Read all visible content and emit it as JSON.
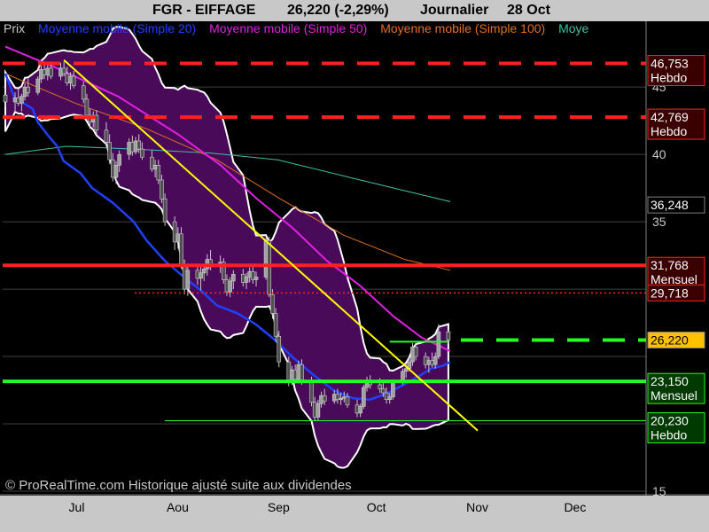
{
  "header": {
    "symbol": "FGR - EIFFAGE",
    "price_change": "26,220 (-2,29%)",
    "period": "Journalier",
    "date": "28 Oct"
  },
  "legend": {
    "items": [
      {
        "label": "Prix",
        "color": "#c8c8c8"
      },
      {
        "label": "Moyenne mobile (Simple 20)",
        "color": "#2040ff"
      },
      {
        "label": "Moyenne mobile (Simple 50)",
        "color": "#e020e0"
      },
      {
        "label": "Moyenne mobile (Simple 100)",
        "color": "#e07020"
      },
      {
        "label": "Moye",
        "color": "#40c0a0"
      }
    ]
  },
  "copyright": "© ProRealTime.com Historique ajusté suite aux dividendes",
  "chart_data": {
    "type": "candlestick",
    "y_axis": {
      "ticks": [
        15,
        20,
        25,
        30,
        35,
        40,
        45
      ],
      "tick_labels": [
        "15",
        "",
        "",
        "",
        "35",
        "40",
        "45"
      ],
      "ylim": [
        15,
        48.5
      ],
      "position": "right"
    },
    "x_axis": {
      "tick_labels": [
        "Jul",
        "Aou",
        "Sep",
        "Oct",
        "Nov",
        "Dec"
      ]
    },
    "horizontal_levels": [
      {
        "value": 46.753,
        "label": "46,753",
        "sublabel": "Hebdo",
        "color": "#ff2020",
        "style": "dashed"
      },
      {
        "value": 42.769,
        "label": "42,769",
        "sublabel": "Hebdo",
        "color": "#ff2020",
        "style": "dashed"
      },
      {
        "value": 31.768,
        "label": "31,768",
        "sublabel": "Mensuel",
        "color": "#ff2020",
        "style": "solid"
      },
      {
        "value": 29.718,
        "label": "29,718",
        "sublabel": "",
        "color": "#ff2020",
        "style": "dotted"
      },
      {
        "value": 26.22,
        "label": "26,220",
        "sublabel": "",
        "color": "#22ff22",
        "style": "dashed"
      },
      {
        "value": 23.15,
        "label": "23,150",
        "sublabel": "Mensuel",
        "color": "#22ff22",
        "style": "solid"
      },
      {
        "value": 20.23,
        "label": "20,230",
        "sublabel": "Hebdo",
        "color": "#22ff22",
        "style": "thin"
      }
    ],
    "value_labels": [
      {
        "value": 36.248,
        "label": "36,248",
        "bg": "#000000",
        "color": "#ffffff"
      },
      {
        "value": 26.22,
        "label": "26,220",
        "bg": "#ffc000",
        "color": "#000000"
      }
    ],
    "trendlines": [
      {
        "name": "downtrend",
        "color": "#ffff00",
        "points": [
          [
            "2024-07-02",
            47.0
          ],
          [
            "2024-11-06",
            19.5
          ]
        ]
      },
      {
        "name": "resistance",
        "color": "#22ff22",
        "points": [
          [
            "2024-10-10",
            26.1
          ],
          [
            "2024-10-28",
            26.1
          ]
        ]
      }
    ],
    "candles": [
      {
        "d": "2024-06-14",
        "o": 44.4,
        "h": 45.0,
        "l": 43.5,
        "c": 43.9
      },
      {
        "d": "2024-06-17",
        "o": 43.9,
        "h": 44.6,
        "l": 43.2,
        "c": 44.2
      },
      {
        "d": "2024-06-18",
        "o": 44.2,
        "h": 44.9,
        "l": 43.6,
        "c": 43.8
      },
      {
        "d": "2024-06-19",
        "o": 43.8,
        "h": 44.5,
        "l": 43.2,
        "c": 44.3
      },
      {
        "d": "2024-06-20",
        "o": 44.3,
        "h": 45.3,
        "l": 44.0,
        "c": 45.0
      },
      {
        "d": "2024-06-21",
        "o": 45.0,
        "h": 45.6,
        "l": 44.3,
        "c": 44.6
      },
      {
        "d": "2024-06-24",
        "o": 44.6,
        "h": 45.8,
        "l": 44.4,
        "c": 45.6
      },
      {
        "d": "2024-06-25",
        "o": 45.6,
        "h": 46.6,
        "l": 45.3,
        "c": 46.3
      },
      {
        "d": "2024-06-26",
        "o": 46.3,
        "h": 46.9,
        "l": 45.6,
        "c": 45.9
      },
      {
        "d": "2024-06-27",
        "o": 45.9,
        "h": 46.7,
        "l": 45.5,
        "c": 46.4
      },
      {
        "d": "2024-06-28",
        "o": 46.4,
        "h": 46.9,
        "l": 45.6,
        "c": 45.8
      },
      {
        "d": "2024-07-01",
        "o": 45.8,
        "h": 46.8,
        "l": 45.5,
        "c": 46.4
      },
      {
        "d": "2024-07-02",
        "o": 46.4,
        "h": 46.9,
        "l": 45.8,
        "c": 46.0
      },
      {
        "d": "2024-07-03",
        "o": 46.0,
        "h": 46.5,
        "l": 45.1,
        "c": 45.3
      },
      {
        "d": "2024-07-04",
        "o": 45.3,
        "h": 46.1,
        "l": 44.8,
        "c": 45.8
      },
      {
        "d": "2024-07-05",
        "o": 45.8,
        "h": 46.2,
        "l": 44.9,
        "c": 45.1
      },
      {
        "d": "2024-07-08",
        "o": 45.1,
        "h": 45.4,
        "l": 43.8,
        "c": 44.1
      },
      {
        "d": "2024-07-09",
        "o": 44.1,
        "h": 44.5,
        "l": 42.6,
        "c": 42.9
      },
      {
        "d": "2024-07-10",
        "o": 42.9,
        "h": 43.4,
        "l": 41.9,
        "c": 42.4
      },
      {
        "d": "2024-07-11",
        "o": 42.4,
        "h": 43.2,
        "l": 42.0,
        "c": 42.9
      },
      {
        "d": "2024-07-12",
        "o": 42.9,
        "h": 43.3,
        "l": 41.5,
        "c": 41.8
      },
      {
        "d": "2024-07-15",
        "o": 41.8,
        "h": 42.4,
        "l": 40.6,
        "c": 40.9
      },
      {
        "d": "2024-07-16",
        "o": 40.9,
        "h": 41.5,
        "l": 39.3,
        "c": 39.6
      },
      {
        "d": "2024-07-17",
        "o": 39.6,
        "h": 40.1,
        "l": 38.0,
        "c": 38.3
      },
      {
        "d": "2024-07-18",
        "o": 38.3,
        "h": 39.5,
        "l": 37.8,
        "c": 39.2
      },
      {
        "d": "2024-07-19",
        "o": 39.2,
        "h": 40.3,
        "l": 38.7,
        "c": 40.0
      },
      {
        "d": "2024-07-22",
        "o": 40.0,
        "h": 41.2,
        "l": 39.6,
        "c": 40.9
      },
      {
        "d": "2024-07-23",
        "o": 40.9,
        "h": 41.4,
        "l": 39.9,
        "c": 40.2
      },
      {
        "d": "2024-07-24",
        "o": 40.2,
        "h": 41.3,
        "l": 40.0,
        "c": 41.0
      },
      {
        "d": "2024-07-25",
        "o": 41.0,
        "h": 41.5,
        "l": 40.1,
        "c": 40.4
      },
      {
        "d": "2024-07-26",
        "o": 40.4,
        "h": 40.9,
        "l": 39.6,
        "c": 39.8
      },
      {
        "d": "2024-07-29",
        "o": 39.8,
        "h": 40.3,
        "l": 38.7,
        "c": 38.9
      },
      {
        "d": "2024-07-30",
        "o": 38.9,
        "h": 39.6,
        "l": 38.3,
        "c": 39.2
      },
      {
        "d": "2024-07-31",
        "o": 39.2,
        "h": 39.6,
        "l": 37.8,
        "c": 38.1
      },
      {
        "d": "2024-08-01",
        "o": 38.1,
        "h": 38.5,
        "l": 36.4,
        "c": 36.7
      },
      {
        "d": "2024-08-02",
        "o": 36.7,
        "h": 37.1,
        "l": 34.7,
        "c": 35.0
      },
      {
        "d": "2024-08-05",
        "o": 35.0,
        "h": 35.4,
        "l": 32.9,
        "c": 33.5
      },
      {
        "d": "2024-08-06",
        "o": 33.5,
        "h": 34.6,
        "l": 33.0,
        "c": 34.1
      },
      {
        "d": "2024-08-07",
        "o": 34.1,
        "h": 34.6,
        "l": 31.5,
        "c": 31.8
      },
      {
        "d": "2024-08-08",
        "o": 31.8,
        "h": 32.2,
        "l": 29.6,
        "c": 30.0
      },
      {
        "d": "2024-08-09",
        "o": 30.0,
        "h": 31.8,
        "l": 29.5,
        "c": 31.4
      },
      {
        "d": "2024-08-12",
        "o": 31.4,
        "h": 31.9,
        "l": 30.3,
        "c": 30.8
      },
      {
        "d": "2024-08-13",
        "o": 30.8,
        "h": 31.7,
        "l": 29.9,
        "c": 31.2
      },
      {
        "d": "2024-08-14",
        "o": 31.2,
        "h": 31.8,
        "l": 30.6,
        "c": 31.5
      },
      {
        "d": "2024-08-15",
        "o": 31.5,
        "h": 32.6,
        "l": 31.0,
        "c": 32.2
      },
      {
        "d": "2024-08-16",
        "o": 32.2,
        "h": 32.9,
        "l": 31.4,
        "c": 31.8
      },
      {
        "d": "2024-08-19",
        "o": 31.8,
        "h": 32.5,
        "l": 31.2,
        "c": 32.0
      },
      {
        "d": "2024-08-20",
        "o": 32.0,
        "h": 32.3,
        "l": 30.4,
        "c": 30.7
      },
      {
        "d": "2024-08-21",
        "o": 30.7,
        "h": 31.1,
        "l": 29.5,
        "c": 29.8
      },
      {
        "d": "2024-08-22",
        "o": 29.8,
        "h": 30.9,
        "l": 29.4,
        "c": 30.6
      },
      {
        "d": "2024-08-23",
        "o": 30.6,
        "h": 31.4,
        "l": 30.0,
        "c": 31.1
      },
      {
        "d": "2024-08-26",
        "o": 31.1,
        "h": 31.5,
        "l": 30.2,
        "c": 30.5
      },
      {
        "d": "2024-08-27",
        "o": 30.5,
        "h": 31.2,
        "l": 30.0,
        "c": 30.9
      },
      {
        "d": "2024-08-28",
        "o": 30.9,
        "h": 31.6,
        "l": 30.5,
        "c": 31.3
      },
      {
        "d": "2024-08-29",
        "o": 31.3,
        "h": 31.7,
        "l": 30.4,
        "c": 30.7
      },
      {
        "d": "2024-08-30",
        "o": 30.7,
        "h": 31.3,
        "l": 30.2,
        "c": 30.9
      },
      {
        "d": "2024-09-02",
        "o": 30.9,
        "h": 33.8,
        "l": 30.7,
        "c": 33.6
      },
      {
        "d": "2024-09-03",
        "o": 33.6,
        "h": 33.9,
        "l": 29.4,
        "c": 29.6
      },
      {
        "d": "2024-09-04",
        "o": 29.6,
        "h": 30.0,
        "l": 27.8,
        "c": 28.2
      },
      {
        "d": "2024-09-05",
        "o": 28.2,
        "h": 28.6,
        "l": 26.1,
        "c": 26.5
      },
      {
        "d": "2024-09-06",
        "o": 26.5,
        "h": 26.9,
        "l": 24.2,
        "c": 24.6
      },
      {
        "d": "2024-09-09",
        "o": 24.6,
        "h": 25.0,
        "l": 22.8,
        "c": 23.2
      },
      {
        "d": "2024-09-10",
        "o": 23.2,
        "h": 24.3,
        "l": 22.9,
        "c": 24.0
      },
      {
        "d": "2024-09-11",
        "o": 24.0,
        "h": 24.4,
        "l": 23.0,
        "c": 23.3
      },
      {
        "d": "2024-09-12",
        "o": 23.3,
        "h": 24.7,
        "l": 23.0,
        "c": 24.4
      },
      {
        "d": "2024-09-13",
        "o": 24.4,
        "h": 24.8,
        "l": 22.9,
        "c": 23.2
      },
      {
        "d": "2024-09-16",
        "o": 23.2,
        "h": 23.5,
        "l": 21.3,
        "c": 21.6
      },
      {
        "d": "2024-09-17",
        "o": 21.6,
        "h": 22.0,
        "l": 20.2,
        "c": 20.5
      },
      {
        "d": "2024-09-18",
        "o": 20.5,
        "h": 21.8,
        "l": 20.2,
        "c": 21.5
      },
      {
        "d": "2024-09-19",
        "o": 21.5,
        "h": 22.4,
        "l": 21.2,
        "c": 22.1
      },
      {
        "d": "2024-09-20",
        "o": 22.1,
        "h": 22.6,
        "l": 21.4,
        "c": 21.7
      },
      {
        "d": "2024-09-23",
        "o": 21.7,
        "h": 22.5,
        "l": 21.5,
        "c": 22.2
      },
      {
        "d": "2024-09-24",
        "o": 22.2,
        "h": 22.6,
        "l": 21.5,
        "c": 21.8
      },
      {
        "d": "2024-09-25",
        "o": 21.8,
        "h": 22.3,
        "l": 21.4,
        "c": 21.9
      },
      {
        "d": "2024-09-26",
        "o": 21.9,
        "h": 22.4,
        "l": 21.6,
        "c": 22.0
      },
      {
        "d": "2024-09-27",
        "o": 22.0,
        "h": 22.3,
        "l": 21.2,
        "c": 21.4
      },
      {
        "d": "2024-09-30",
        "o": 21.4,
        "h": 21.8,
        "l": 20.5,
        "c": 20.8
      },
      {
        "d": "2024-10-01",
        "o": 20.8,
        "h": 21.5,
        "l": 20.5,
        "c": 21.3
      },
      {
        "d": "2024-10-02",
        "o": 21.3,
        "h": 22.9,
        "l": 21.1,
        "c": 22.7
      },
      {
        "d": "2024-10-03",
        "o": 22.7,
        "h": 23.5,
        "l": 22.4,
        "c": 23.2
      },
      {
        "d": "2024-10-04",
        "o": 23.2,
        "h": 23.6,
        "l": 22.6,
        "c": 22.9
      },
      {
        "d": "2024-10-07",
        "o": 22.9,
        "h": 23.4,
        "l": 22.3,
        "c": 22.6
      },
      {
        "d": "2024-10-08",
        "o": 22.6,
        "h": 23.1,
        "l": 22.0,
        "c": 22.3
      },
      {
        "d": "2024-10-09",
        "o": 22.3,
        "h": 22.7,
        "l": 21.5,
        "c": 21.8
      },
      {
        "d": "2024-10-10",
        "o": 21.8,
        "h": 22.3,
        "l": 21.5,
        "c": 22.0
      },
      {
        "d": "2024-10-11",
        "o": 22.0,
        "h": 23.3,
        "l": 21.8,
        "c": 23.1
      },
      {
        "d": "2024-10-14",
        "o": 23.1,
        "h": 24.1,
        "l": 22.9,
        "c": 23.9
      },
      {
        "d": "2024-10-15",
        "o": 23.9,
        "h": 24.5,
        "l": 23.4,
        "c": 24.1
      },
      {
        "d": "2024-10-16",
        "o": 24.1,
        "h": 24.9,
        "l": 23.9,
        "c": 24.6
      },
      {
        "d": "2024-10-17",
        "o": 24.6,
        "h": 26.0,
        "l": 24.3,
        "c": 25.7
      },
      {
        "d": "2024-10-18",
        "o": 25.7,
        "h": 26.0,
        "l": 24.7,
        "c": 25.0
      },
      {
        "d": "2024-10-21",
        "o": 25.0,
        "h": 25.3,
        "l": 24.1,
        "c": 24.4
      },
      {
        "d": "2024-10-22",
        "o": 24.4,
        "h": 25.0,
        "l": 23.8,
        "c": 24.7
      },
      {
        "d": "2024-10-23",
        "o": 24.7,
        "h": 25.3,
        "l": 24.2,
        "c": 24.4
      },
      {
        "d": "2024-10-24",
        "o": 24.4,
        "h": 25.3,
        "l": 24.1,
        "c": 25.0
      },
      {
        "d": "2024-10-25",
        "o": 25.0,
        "h": 27.4,
        "l": 24.8,
        "c": 26.83
      },
      {
        "d": "2024-10-28",
        "o": 26.83,
        "h": 27.0,
        "l": 25.9,
        "c": 26.22
      }
    ],
    "ma20": [
      [
        43.6,
        46
      ],
      [
        44.3,
        44.2
      ],
      [
        45.7,
        43.4
      ],
      [
        46.1,
        42.4
      ],
      [
        46.9,
        41.4
      ],
      [
        47.6,
        40.6
      ],
      [
        48.1,
        39.5
      ],
      [
        49.4,
        38.6
      ],
      [
        50.3,
        37.5
      ],
      [
        51.9,
        36.4
      ],
      [
        53.5,
        35
      ],
      [
        54.5,
        33.6
      ],
      [
        55.9,
        32.1
      ],
      [
        57.5,
        30.8
      ],
      [
        58.8,
        29.8
      ],
      [
        59.9,
        28.8
      ],
      [
        61.5,
        28.2
      ],
      [
        62.9,
        27.4
      ],
      [
        64.3,
        26.3
      ],
      [
        65.8,
        24.9
      ],
      [
        67.4,
        23.6
      ],
      [
        68.9,
        22.5
      ],
      [
        70.4,
        21.9
      ],
      [
        71.7,
        21.8
      ],
      [
        72.9,
        22.2
      ],
      [
        74.3,
        22.9
      ],
      [
        75.6,
        23.6
      ],
      [
        76.4,
        24.1
      ],
      [
        77.3,
        24.3
      ],
      [
        77.9,
        24.6
      ]
    ],
    "ma50": [
      [
        43.6,
        48
      ],
      [
        47.6,
        46.4
      ],
      [
        52.3,
        44.3
      ],
      [
        56.9,
        41.5
      ],
      [
        60.2,
        39.2
      ],
      [
        63,
        36.7
      ],
      [
        65.8,
        34.5
      ],
      [
        68.4,
        32.1
      ],
      [
        70.9,
        30.3
      ],
      [
        73.5,
        28
      ],
      [
        75.7,
        26.4
      ],
      [
        77.9,
        25.4
      ]
    ],
    "ma100": [
      [
        43.6,
        46
      ],
      [
        49,
        43.8
      ],
      [
        54.5,
        41.9
      ],
      [
        59.9,
        39.6
      ],
      [
        64.8,
        36.7
      ],
      [
        69.7,
        34
      ],
      [
        74.4,
        32.2
      ],
      [
        77.9,
        31.4
      ]
    ],
    "ma_extra": [
      [
        43.6,
        40
      ],
      [
        48.3,
        40.6
      ],
      [
        53.5,
        40.4
      ],
      [
        59.4,
        40.1
      ],
      [
        64.6,
        39.6
      ],
      [
        69.7,
        38.4
      ],
      [
        74.4,
        37.3
      ],
      [
        77.9,
        36.5
      ]
    ]
  }
}
